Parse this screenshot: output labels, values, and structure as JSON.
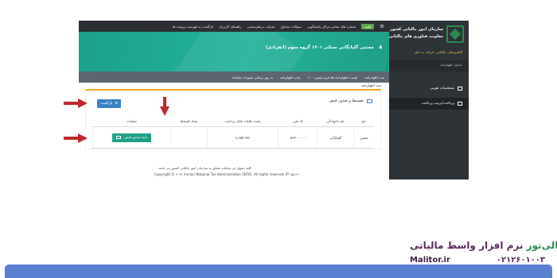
{
  "topbar": {
    "menu_icon": "≡",
    "pill": "تکلیف",
    "links": [
      "شماره های تماس مراکز پاسخگویی",
      "سوالات متداول",
      "شرکت درنظرسنجی",
      "راهنمای کاربران",
      "بازگشت به فهرست پرونده ها"
    ]
  },
  "header": {
    "user_name": "مجتبی گلپایگانی ستکنر ۱۴۰۱ گروه سوم (انفرادی)"
  },
  "toolbar": {
    "items": [
      "ثبت اظهارنامه",
      "لیست اظهارنامه ها، فرم تبصره ۱۰۰",
      "چاپ اظهارنامه",
      "به روز رسانی تغییرات سامانه"
    ]
  },
  "sidebar": {
    "org_line1": "سازمان امور مالیاتی کشور",
    "org_line2": "معاونت فناوری های مالیاتی",
    "slogan": "الکترونیکی مالیاتی، حرکت به جلو",
    "menu_label": "جداول اظهارنامه",
    "items": [
      {
        "label": "مشخصات هویتی"
      },
      {
        "label": "پرداخت/ترتیب پرداخت"
      }
    ]
  },
  "panel": {
    "title": "تقسیط و صدور قبض",
    "back_button": "بازگشت",
    "columns": [
      "نام",
      "نام خانوادگی",
      "کد ملی",
      "مانده مالیات قابل پرداخت",
      "تعداد اقساط",
      "عملیات"
    ],
    "rows": [
      [
        "مجتبی",
        "گلپایگانی",
        "۰۵۲۲۰۰۰۰۰۰",
        "۹,۶۵۴,۲۷۶",
        "",
        "تایید صدور قبض"
      ]
    ]
  },
  "footer": {
    "line1": "کلیه حقوق این سامانه متعلق به سازمان امور مالیاتی کشور می باشد",
    "line2": "Copyright © ۲۰۲۳ Iranian National Tax Administration (INTA). All rights reserved. IP: ۵۵.۶۶"
  },
  "brand": {
    "name_a": "مالی‌تور",
    "name_b": " نرم افزار واسط مالیاتی",
    "site": "Malitor.ir",
    "phone": "۰۲۱۲۶۰۱۰۰۳"
  },
  "colors": {
    "header_green": "#1aa18b",
    "sidebar_dark": "#2e3338",
    "button_blue": "#3b82c4",
    "arrow_red": "#c0282d"
  }
}
